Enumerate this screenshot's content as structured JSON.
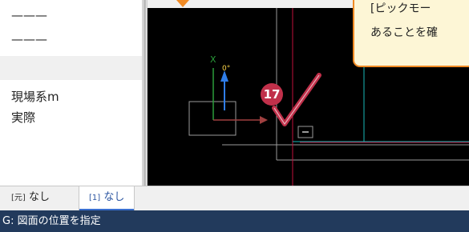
{
  "properties": {
    "rows": [
      "———",
      "———",
      "",
      "現場系m",
      "実際"
    ]
  },
  "viewport": {
    "axis_labels": {
      "x": "X",
      "angle": "0°"
    },
    "step_badge": "17",
    "colors": {
      "background": "#000000",
      "x_axis_red": "#c0103a",
      "y_axis_blue": "#2f7de8",
      "cyan": "#18b8b8",
      "green": "#2a9d3a",
      "gray": "#9a9a9a",
      "check_mark": "#c0304a"
    }
  },
  "tooltip": {
    "line1": "[ピックモー",
    "line2": "あることを確"
  },
  "tabs": [
    {
      "prefix": "[元]",
      "label": "なし"
    },
    {
      "prefix": "[1]",
      "label": "なし"
    }
  ],
  "status": {
    "text": "G: 図面の位置を指定"
  }
}
